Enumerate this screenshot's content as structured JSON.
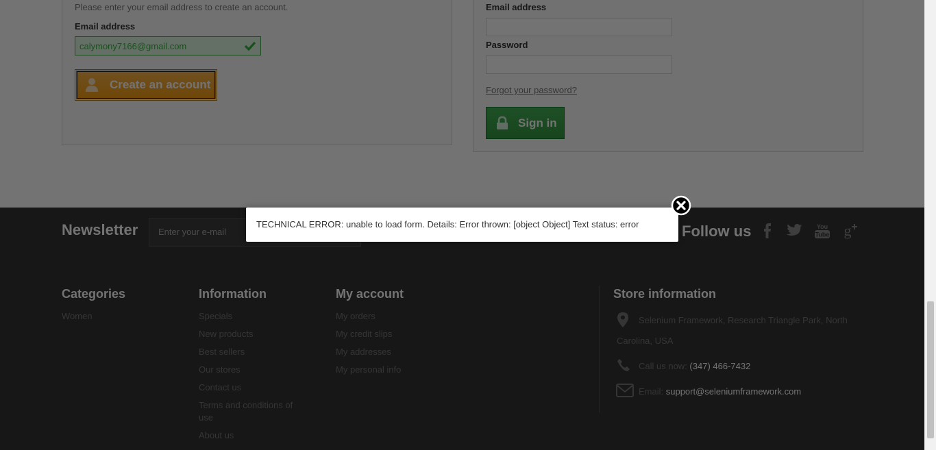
{
  "create_account": {
    "intro": "Please enter your email address to create an account.",
    "email_label": "Email address",
    "email_value": "calymony7166@gmail.com",
    "button": "Create an account"
  },
  "login": {
    "email_label": "Email address",
    "password_label": "Password",
    "forgot": "Forgot your password?",
    "button": "Sign in"
  },
  "newsletter": {
    "title": "Newsletter",
    "placeholder": "Enter your e-mail",
    "follow": "Follow us",
    "social": [
      "facebook-icon",
      "twitter-icon",
      "youtube-icon",
      "google-plus-icon"
    ]
  },
  "footer": {
    "categories": {
      "title": "Categories",
      "items": [
        "Women"
      ]
    },
    "information": {
      "title": "Information",
      "items": [
        "Specials",
        "New products",
        "Best sellers",
        "Our stores",
        "Contact us",
        "Terms and conditions of",
        "use",
        "About us"
      ]
    },
    "my_account": {
      "title": "My account",
      "items": [
        "My orders",
        "My credit slips",
        "My addresses",
        "My personal info"
      ]
    },
    "store": {
      "title": "Store information",
      "address_1": "Selenium Framework, Research Triangle Park, North",
      "address_2": "Carolina, USA",
      "call_label": "Call us now: ",
      "phone": "(347) 466-7432",
      "email_label": "Email: ",
      "email": "support@seleniumframework.com"
    }
  },
  "modal": {
    "message": "TECHNICAL ERROR: unable to load form. Details: Error thrown: [object Object] Text status: error"
  },
  "colors": {
    "success": "#46a74e",
    "button_orange": "#f39c11",
    "button_green": "#359840",
    "footer_bg": "#333333"
  }
}
